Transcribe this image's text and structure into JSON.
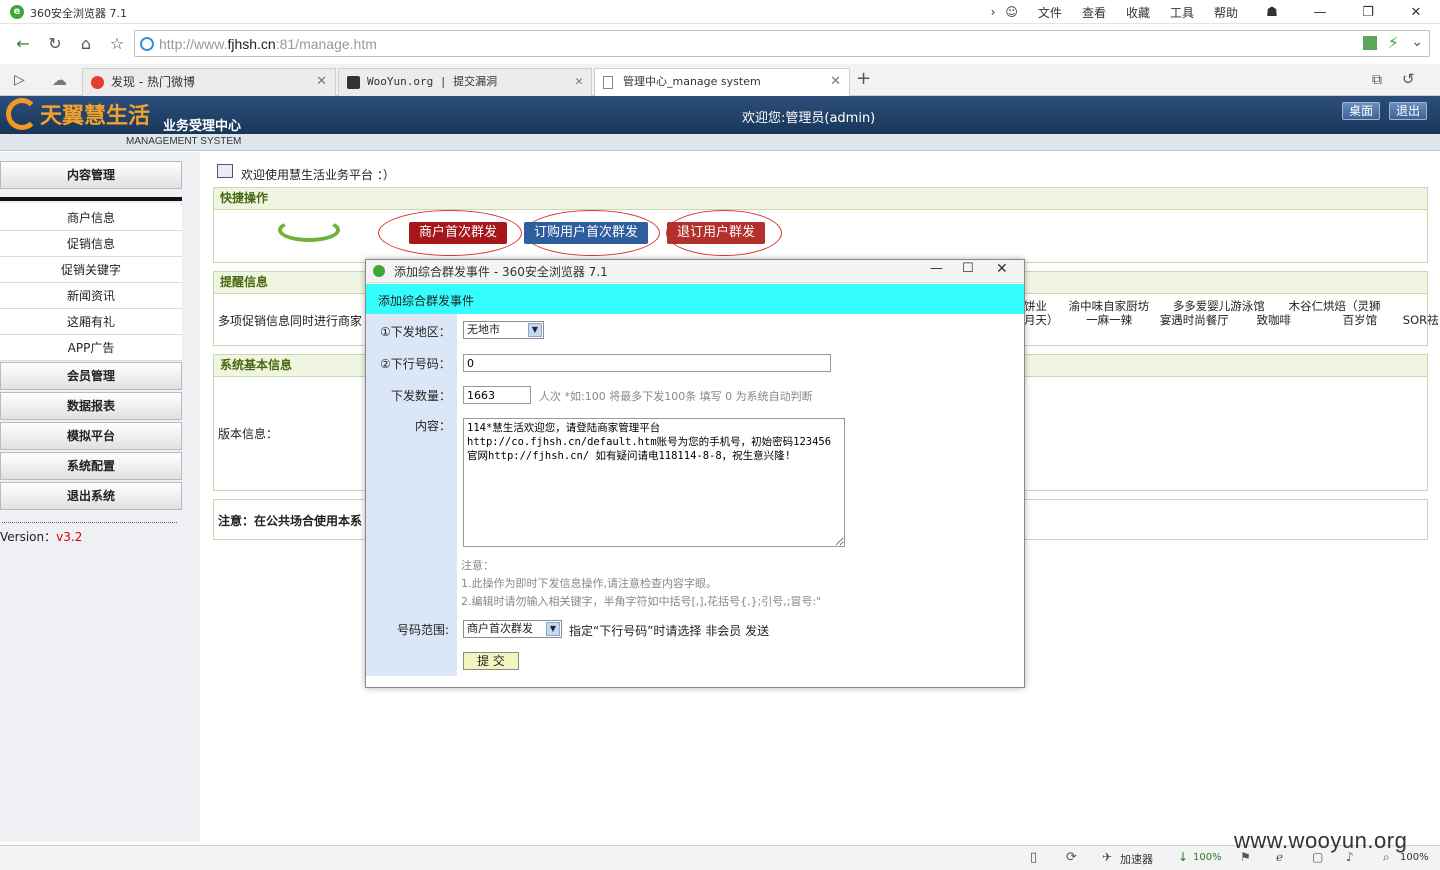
{
  "browser": {
    "title": "360安全浏览器 7.1",
    "menu": [
      "文件",
      "查看",
      "收藏",
      "工具",
      "帮助"
    ],
    "url_prefix": "http://www.",
    "url_host": "fjhsh.cn",
    "url_suffix": ":81/manage.htm",
    "tabs": [
      {
        "label": "发现 - 热门微博",
        "icon": "weibo-icon"
      },
      {
        "label": "WooYun.org | 提交漏洞",
        "icon": "wooyun-icon"
      },
      {
        "label": "管理中心_manage system",
        "icon": "page-icon"
      }
    ]
  },
  "header": {
    "logo": "天翼慧生活",
    "subtitle": "业务受理中心",
    "subtitle_en": "MANAGEMENT SYSTEM",
    "welcome": "欢迎您:管理员(admin)",
    "btn_desktop": "桌面",
    "btn_logout": "退出"
  },
  "sidebar": {
    "content_mgmt": "内容管理",
    "items": [
      "商户信息",
      "促销信息",
      "促销关键字",
      "新闻资讯",
      "这厢有礼",
      "APP广告"
    ],
    "groups": [
      "会员管理",
      "数据报表",
      "模拟平台",
      "系统配置",
      "退出系统"
    ],
    "version_label": "Version：",
    "version": "v3.2"
  },
  "main": {
    "welcome": "欢迎使用慧生活业务平台 ：）",
    "quick_title": "快捷操作",
    "quick_buttons": [
      "商户首次群发",
      "订购用户首次群发",
      "退订用户群发"
    ],
    "remind_title": "提醒信息",
    "remind_text": "多项促销信息同时进行商家",
    "remind_shops_row1": [
      "饼业",
      "渝中味自家厨坊",
      "多多爱婴儿游泳馆",
      "木谷仁烘焙（灵狮"
    ],
    "remind_shops_row2": [
      "月天）",
      "一麻一辣",
      "宴遇时尚餐厅",
      "致咖啡",
      "百岁馆",
      "SOR祛"
    ],
    "sysinfo_title": "系统基本信息",
    "version_info": "版本信息：",
    "notice": "注意：在公共场合使用本系"
  },
  "popup": {
    "window_title": "添加综合群发事件 - 360安全浏览器 7.1",
    "band_title": "添加综合群发事件",
    "region_label": "①下发地区：",
    "region_value": "无地市",
    "number_label": "②下行号码：",
    "number_value": "0",
    "count_label": "下发数量：",
    "count_value": "1663",
    "count_hint": "人次 *如:100 将最多下发100条 填写 0 为系统自动判断",
    "content_label": "内容：",
    "content_value": "114*慧生活欢迎您，请登陆商家管理平台http://co.fjhsh.cn/default.htm账号为您的手机号，初始密码123456官网http://fjhsh.cn/ 如有疑问请电118114-8-8，祝生意兴隆!",
    "notice_title": "注意：",
    "notice_1": "1.此操作为即时下发信息操作,请注意检查内容字眼。",
    "notice_2": "2.编辑时请勿输入相关键字，半角字符如中括号[,],花括号{,};引号,;冒号:\"",
    "range_label": "号码范围:",
    "range_value": "商户首次群发",
    "range_hint": "指定“下行号码”时请选择 非会员 发送",
    "submit": "提 交"
  },
  "statusbar": {
    "accelerator": "加速器",
    "download_pct": "100%",
    "zoom": "100%",
    "watermark": "www.wooyun.org"
  },
  "colors": {
    "header_bg": "#1f3f68",
    "popup_band": "#35fdfd",
    "btn_merchant": "#a5171a",
    "btn_subscribe": "#2f5e9e",
    "btn_unsubscribe": "#b3302c"
  }
}
